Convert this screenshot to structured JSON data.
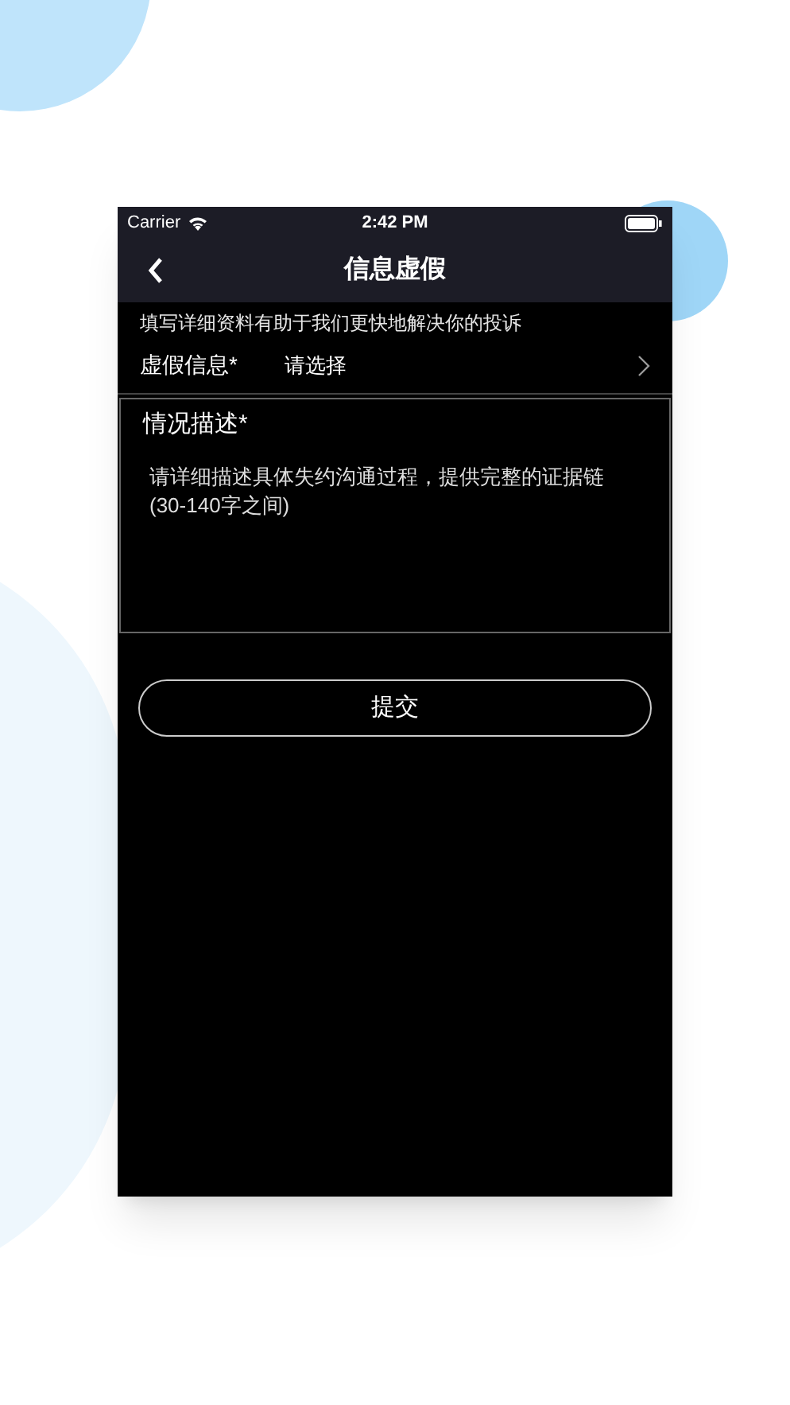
{
  "status_bar": {
    "carrier": "Carrier",
    "time": "2:42 PM"
  },
  "nav": {
    "title": "信息虚假"
  },
  "hint": "填写详细资料有助于我们更快地解决你的投诉",
  "select_row": {
    "label": "虚假信息*",
    "value": "请选择"
  },
  "description": {
    "label": "情况描述*",
    "placeholder": [
      "请详细描述具体失约沟通过程，提供完整的证据链",
      "(30-140字之间)"
    ]
  },
  "submit": "提交"
}
